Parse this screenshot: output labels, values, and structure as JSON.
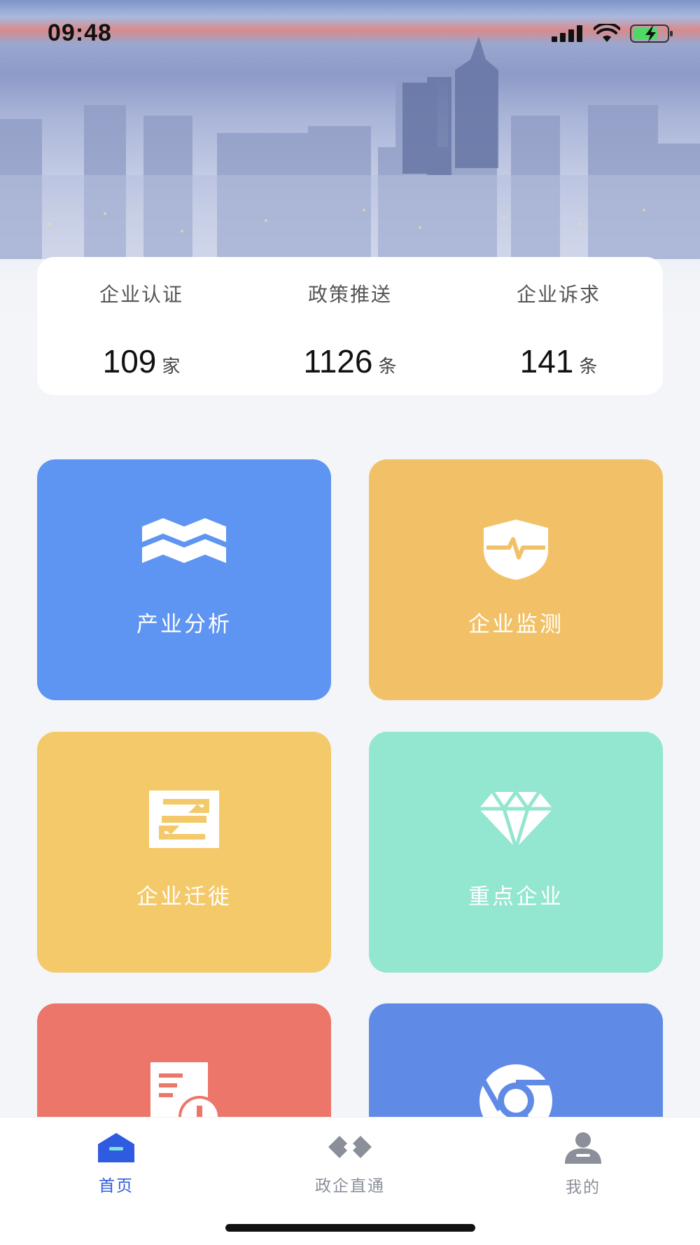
{
  "status_bar": {
    "time": "09:48"
  },
  "stats": [
    {
      "label": "企业认证",
      "value": "109",
      "unit": "家"
    },
    {
      "label": "政策推送",
      "value": "1126",
      "unit": "条"
    },
    {
      "label": "企业诉求",
      "value": "141",
      "unit": "条"
    }
  ],
  "tiles": [
    {
      "label": "产业分析",
      "icon": "map-icon",
      "color": "#5f95f2"
    },
    {
      "label": "企业监测",
      "icon": "shield-pulse-icon",
      "color": "#f2c167"
    },
    {
      "label": "企业迁徙",
      "icon": "migration-icon",
      "color": "#f4c96a"
    },
    {
      "label": "重点企业",
      "icon": "diamond-icon",
      "color": "#93e6cf"
    },
    {
      "label": "",
      "icon": "document-alert-icon",
      "color": "#ec766a"
    },
    {
      "label": "",
      "icon": "chrome-icon",
      "color": "#5f8be6"
    }
  ],
  "tabbar": {
    "items": [
      {
        "label": "首页",
        "icon": "home-icon",
        "active": true
      },
      {
        "label": "政企直通",
        "icon": "link-icon",
        "active": false
      },
      {
        "label": "我的",
        "icon": "user-icon",
        "active": false
      }
    ],
    "active_color": "#2f5be0",
    "inactive_color": "#8a8f99"
  }
}
